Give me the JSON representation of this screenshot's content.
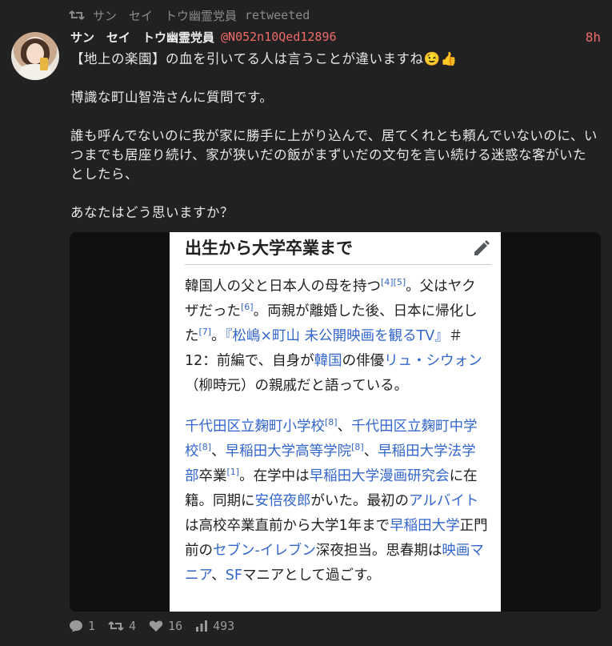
{
  "retweet": {
    "icon": "retweet-icon",
    "user": "サン　セイ　トウ幽霊党員",
    "label": "retweeted"
  },
  "tweet": {
    "avatar_icon": "user-avatar",
    "display_name": "サン　セイ　トウ幽霊党員",
    "handle": "@N052n10Qed12896",
    "time": "8h",
    "paragraphs": [
      "【地上の楽園】の血を引いてる人は言うことが違いますね😉👍",
      "博識な町山智浩さんに質問です。",
      "誰も呼んでないのに我が家に勝手に上がり込んで、居てくれとも頼んでいないのに、いつまでも居座り続け、家が狭いだの飯がまずいだの文句を言い続ける迷惑な客がいたとしたら、",
      "あなたはどう思いますか？"
    ]
  },
  "wiki": {
    "title": "出生から大学卒業まで",
    "edit_icon": "pencil-icon",
    "para1": [
      {
        "t": "韓国人の父と日本人の母を持つ"
      },
      {
        "t": "[4]",
        "sup": true
      },
      {
        "t": "[5]",
        "sup": true
      },
      {
        "t": "。父はヤクザだった"
      },
      {
        "t": "[6]",
        "sup": true
      },
      {
        "t": "。両親が離婚した後、日本に帰化した"
      },
      {
        "t": "[7]",
        "sup": true
      },
      {
        "t": "。"
      },
      {
        "t": "『松嶋×町山 未公開映画を観るTV』",
        "link": true
      },
      {
        "t": "＃12：前編で、自身が"
      },
      {
        "t": "韓国",
        "link": true
      },
      {
        "t": "の俳優"
      },
      {
        "t": "リュ・シウォン",
        "link": true
      },
      {
        "t": "（柳時元）の親戚だと語っている。"
      }
    ],
    "para2": [
      {
        "t": "千代田区立麹町小学校",
        "link": true
      },
      {
        "t": "[8]",
        "sup": true
      },
      {
        "t": "、"
      },
      {
        "t": "千代田区立麹町中学校",
        "link": true
      },
      {
        "t": "[8]",
        "sup": true
      },
      {
        "t": "、"
      },
      {
        "t": "早稲田大学高等学院",
        "link": true
      },
      {
        "t": "[8]",
        "sup": true
      },
      {
        "t": "、"
      },
      {
        "t": "早稲田大学法学部",
        "link": true
      },
      {
        "t": "卒業"
      },
      {
        "t": "[1]",
        "sup": true
      },
      {
        "t": "。在学中は"
      },
      {
        "t": "早稲田大学漫画研究会",
        "link": true
      },
      {
        "t": "に在籍。同期に"
      },
      {
        "t": "安倍夜郎",
        "link": true
      },
      {
        "t": "がいた。最初の"
      },
      {
        "t": "アルバイト",
        "link": true
      },
      {
        "t": "は高校卒業直前から大学1年まで"
      },
      {
        "t": "早稲田大学",
        "link": true
      },
      {
        "t": "正門前の"
      },
      {
        "t": "セブン-イレブン",
        "link": true
      },
      {
        "t": "深夜担当。思春期は"
      },
      {
        "t": "映画マニア",
        "link": true
      },
      {
        "t": "、"
      },
      {
        "t": "SF",
        "link": true
      },
      {
        "t": "マニアとして過ごす。"
      }
    ]
  },
  "actions": {
    "reply": {
      "icon": "reply-icon",
      "count": "1"
    },
    "retweet": {
      "icon": "retweet-icon",
      "count": "4"
    },
    "like": {
      "icon": "heart-icon",
      "count": "16"
    },
    "views": {
      "icon": "views-icon",
      "count": "493"
    }
  },
  "colors": {
    "background": "#212121",
    "handle": "#f06a6a",
    "wiki_link": "#3366cc"
  }
}
